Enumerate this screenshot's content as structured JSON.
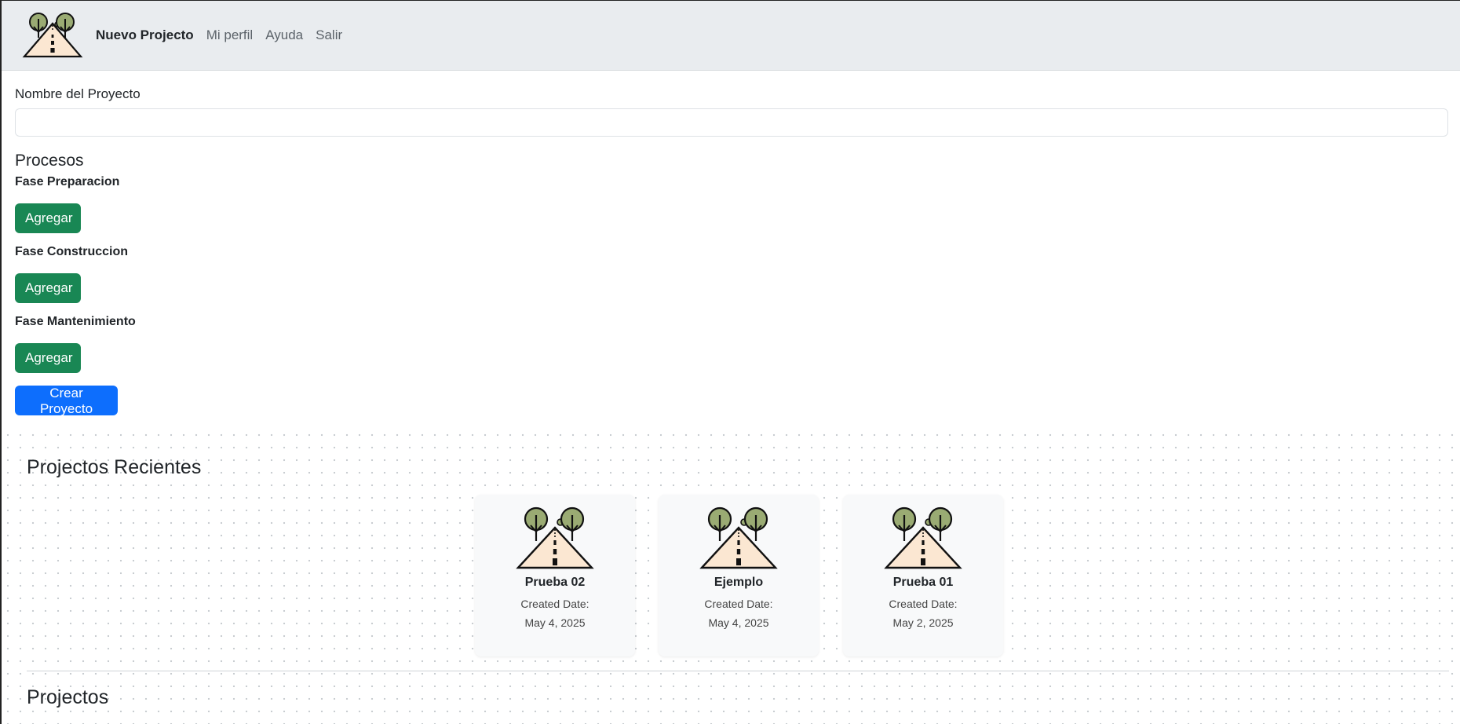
{
  "navbar": {
    "logo_icon": "road-trees-logo-icon",
    "links": [
      {
        "label": "Nuevo Projecto",
        "active": true
      },
      {
        "label": "Mi perfil",
        "active": false
      },
      {
        "label": "Ayuda",
        "active": false
      },
      {
        "label": "Salir",
        "active": false
      }
    ]
  },
  "form": {
    "name_label": "Nombre del Proyecto",
    "name_value": "",
    "processes_title": "Procesos",
    "phases": [
      {
        "label": "Fase Preparacion",
        "button": "Agregar"
      },
      {
        "label": "Fase Construccion",
        "button": "Agregar"
      },
      {
        "label": "Fase Mantenimiento",
        "button": "Agregar"
      }
    ],
    "submit_label": "Crear Proyecto"
  },
  "recent": {
    "title": "Projectos Recientes",
    "projects": [
      {
        "name": "Prueba 02",
        "created_label": "Created Date:",
        "date": "May 4, 2025",
        "icon": "road-trees-icon"
      },
      {
        "name": "Ejemplo",
        "created_label": "Created Date:",
        "date": "May 4, 2025",
        "icon": "road-trees-icon"
      },
      {
        "name": "Prueba 01",
        "created_label": "Created Date:",
        "date": "May 2, 2025",
        "icon": "road-trees-icon"
      }
    ]
  },
  "projects": {
    "title": "Projectos"
  },
  "colors": {
    "success": "#198754",
    "primary": "#0d6efd",
    "navbar_bg": "#e9ecef",
    "tree_green": "#9aab73",
    "road_fill": "#fbe7d2"
  }
}
